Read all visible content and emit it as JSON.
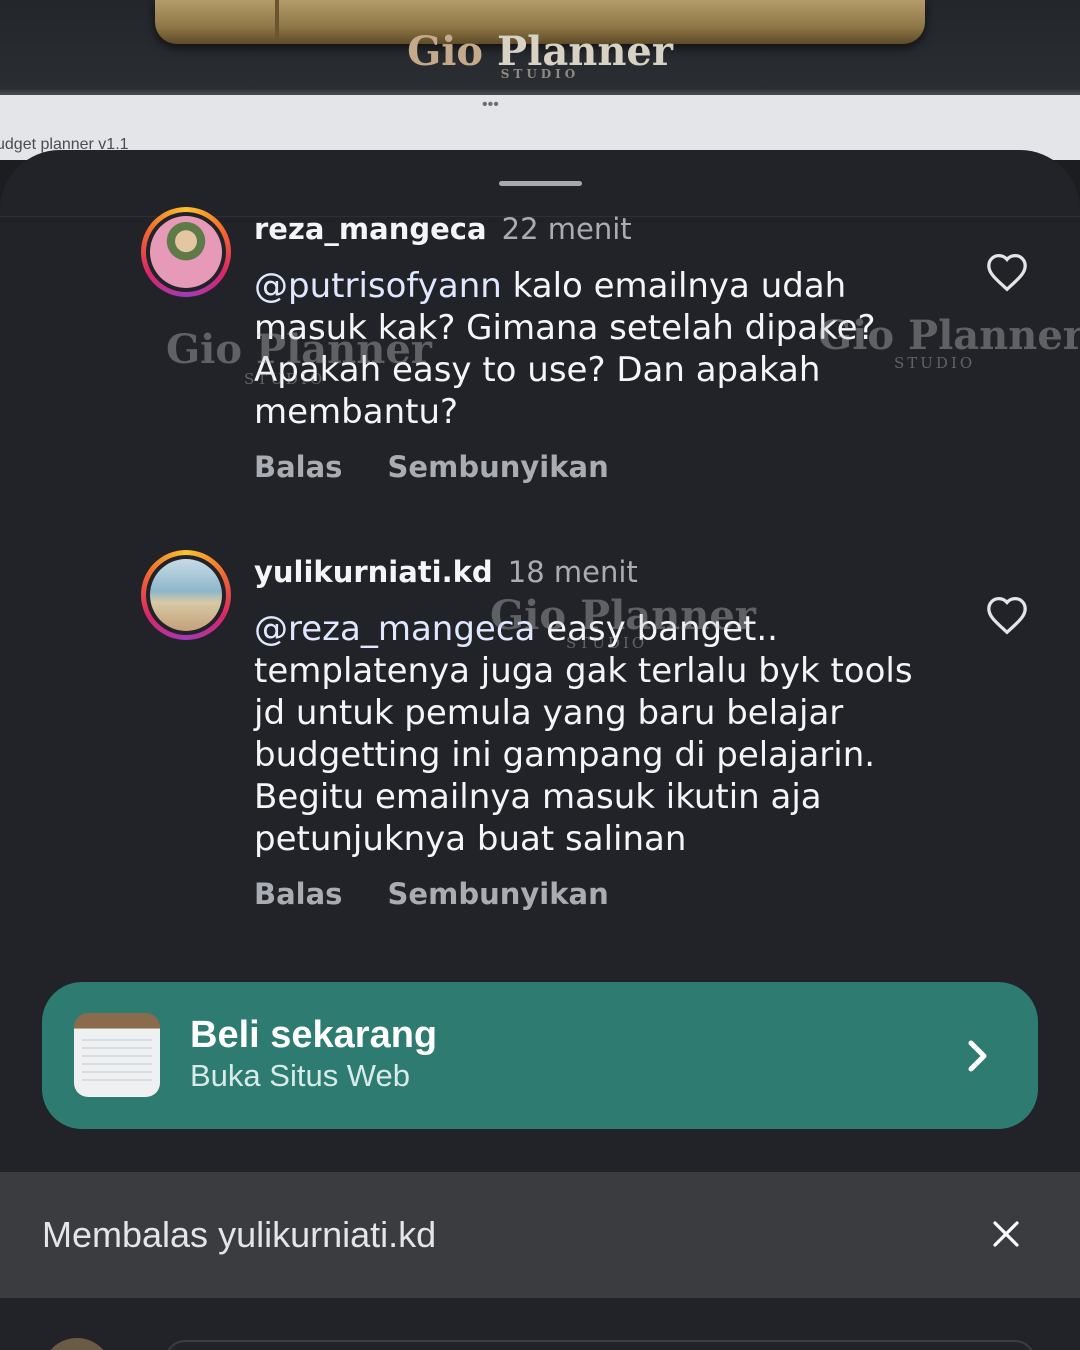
{
  "background": {
    "brand": "Gio Planner",
    "brand_gio": "Gio",
    "brand_planner": "Planner",
    "brand_studio": "STUDIO",
    "window_title": "udget planner v1.1",
    "window_dots": "•••"
  },
  "comments": [
    {
      "username": "reza_mangeca",
      "time": "22 menit",
      "mention": "@putrisofyann",
      "text": " kalo emailnya udah masuk kak? Gimana setelah dipake? Apakah easy to use? Dan apakah membantu?",
      "reply_label": "Balas",
      "hide_label": "Sembunyikan"
    },
    {
      "username": "yulikurniati.kd",
      "time": "18 menit",
      "mention": "@reza_mangeca",
      "text": " easy banget.. templatenya juga gak terlalu byk tools jd untuk pemula yang baru belajar budgetting ini gampang di pelajarin. Begitu emailnya masuk ikutin aja petunjuknya buat salinan",
      "reply_label": "Balas",
      "hide_label": "Sembunyikan"
    }
  ],
  "watermark": {
    "gio": "Gio",
    "planner": "Planner",
    "studio": "STUDIO"
  },
  "cta": {
    "title": "Beli sekarang",
    "subtitle": "Buka Situs Web"
  },
  "reply_bar": {
    "text": "Membalas yulikurniati.kd"
  },
  "colors": {
    "sheet": "#212328",
    "cta": "#2e7b72",
    "reply_bar": "#3a3c40"
  }
}
